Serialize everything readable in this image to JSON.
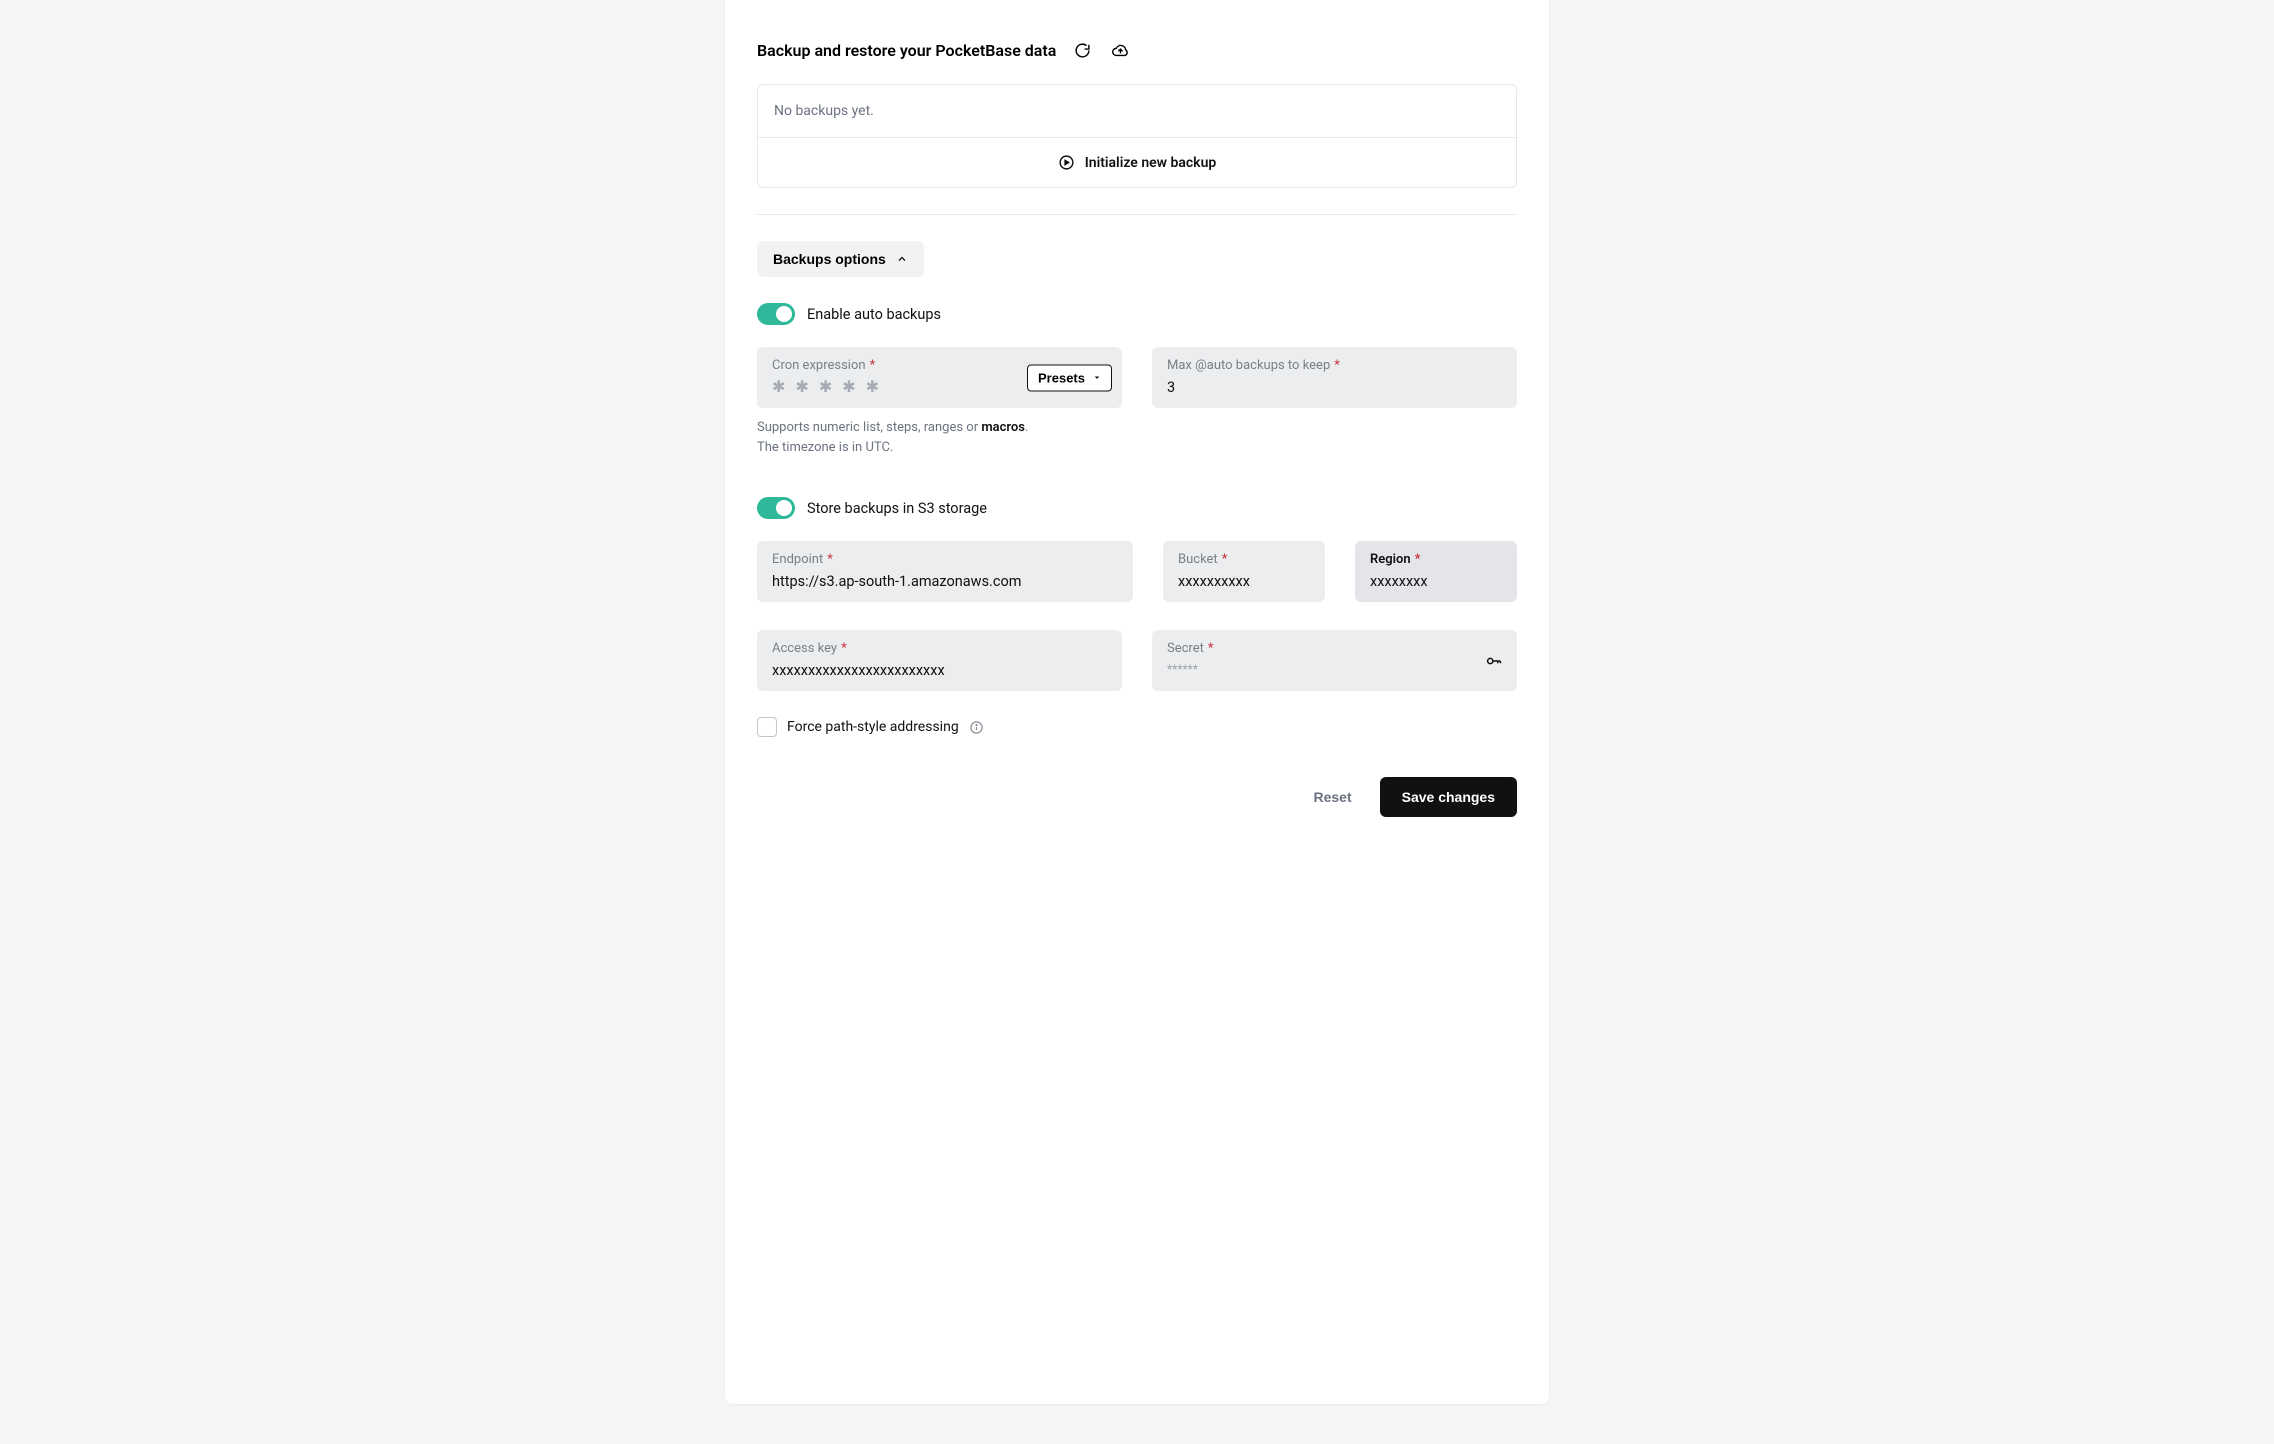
{
  "header": {
    "title": "Backup and restore your PocketBase data"
  },
  "backups": {
    "empty_text": "No backups yet.",
    "init_label": "Initialize new backup"
  },
  "options_button": "Backups options",
  "auto_backups": {
    "enable_label": "Enable auto backups",
    "cron": {
      "label": "Cron expression",
      "placeholder": "✱  ✱  ✱  ✱  ✱",
      "presets_label": "Presets",
      "help_1_prefix": "Supports numeric list, steps, ranges or ",
      "help_1_link": "macros",
      "help_1_suffix": ".",
      "help_2": "The timezone is in UTC."
    },
    "max": {
      "label": "Max @auto backups to keep",
      "value": "3"
    }
  },
  "s3": {
    "enable_label": "Store backups in S3 storage",
    "endpoint": {
      "label": "Endpoint",
      "value": "https://s3.ap-south-1.amazonaws.com"
    },
    "bucket": {
      "label": "Bucket",
      "value": "xxxxxxxxxx"
    },
    "region": {
      "label": "Region",
      "value": "xxxxxxxx"
    },
    "access_key": {
      "label": "Access key",
      "value": "xxxxxxxxxxxxxxxxxxxxxxxx"
    },
    "secret": {
      "label": "Secret",
      "placeholder": "******"
    },
    "force_path": {
      "label": "Force path-style addressing"
    }
  },
  "footer": {
    "reset": "Reset",
    "save": "Save changes"
  }
}
